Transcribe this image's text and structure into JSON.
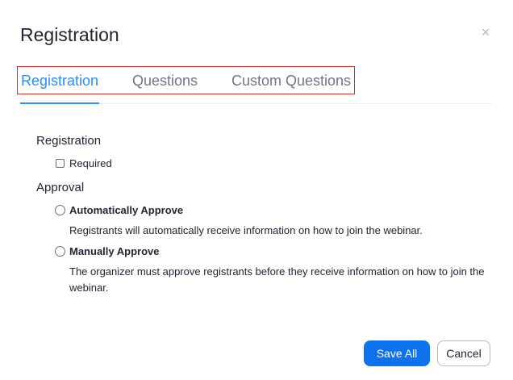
{
  "dialog": {
    "title": "Registration",
    "close_glyph": "×"
  },
  "tabs": [
    {
      "label": "Registration",
      "active": true
    },
    {
      "label": "Questions",
      "active": false
    },
    {
      "label": "Custom Questions",
      "active": false
    }
  ],
  "registration_section": {
    "heading": "Registration",
    "required_label": "Required",
    "required_checked": false
  },
  "approval_section": {
    "heading": "Approval",
    "options": [
      {
        "label": "Automatically Approve",
        "description": "Registrants will automatically receive information on how to join the webinar.",
        "selected": false
      },
      {
        "label": "Manually Approve",
        "description": "The organizer must approve registrants before they receive information on how to join the webinar.",
        "selected": false
      }
    ]
  },
  "footer": {
    "save_label": "Save All",
    "cancel_label": "Cancel"
  },
  "colors": {
    "accent": "#2d8cff",
    "primary_button": "#0e72ed",
    "highlight_border": "#d0332c"
  }
}
